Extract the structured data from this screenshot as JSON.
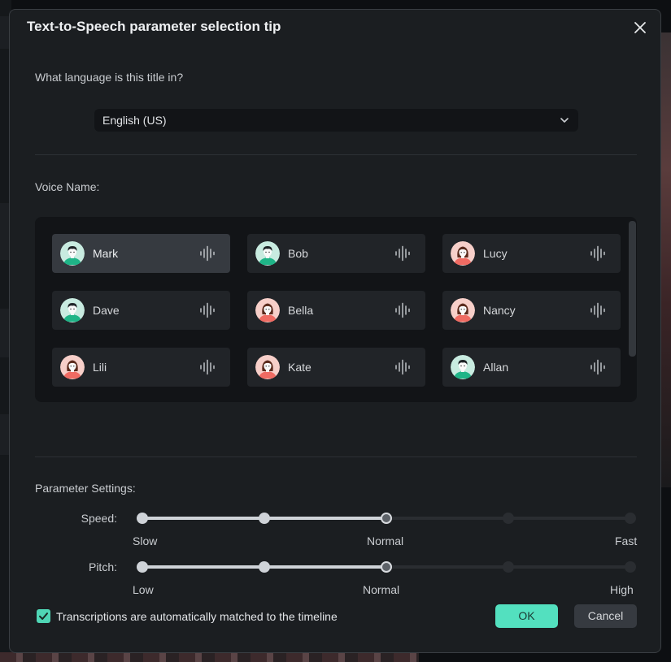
{
  "dialog": {
    "title": "Text-to-Speech parameter selection tip",
    "close_icon": "close-icon"
  },
  "language": {
    "question": "What language is this title in?",
    "selected": "English (US)"
  },
  "voices": {
    "label": "Voice Name:",
    "selected": "Mark",
    "items": [
      {
        "name": "Mark",
        "gender": "male"
      },
      {
        "name": "Bob",
        "gender": "male"
      },
      {
        "name": "Lucy",
        "gender": "female"
      },
      {
        "name": "Dave",
        "gender": "male"
      },
      {
        "name": "Bella",
        "gender": "female"
      },
      {
        "name": "Nancy",
        "gender": "female"
      },
      {
        "name": "Lili",
        "gender": "female"
      },
      {
        "name": "Kate",
        "gender": "female"
      },
      {
        "name": "Allan",
        "gender": "male"
      }
    ]
  },
  "parameters": {
    "label": "Parameter Settings:",
    "speed": {
      "label": "Speed:",
      "steps": 5,
      "value_step": 3,
      "min_label": "Slow",
      "mid_label": "Normal",
      "max_label": "Fast"
    },
    "pitch": {
      "label": "Pitch:",
      "steps": 5,
      "value_step": 3,
      "min_label": "Low",
      "mid_label": "Normal",
      "max_label": "High"
    }
  },
  "footer": {
    "auto_match_checked": true,
    "auto_match_label": "Transcriptions are automatically matched to the timeline",
    "ok_label": "OK",
    "cancel_label": "Cancel"
  },
  "colors": {
    "accent": "#53e0bf",
    "dialog_bg": "#1b1e21",
    "male_avatar_bg": "#c8ebe0",
    "female_avatar_bg": "#f7cfc9"
  }
}
